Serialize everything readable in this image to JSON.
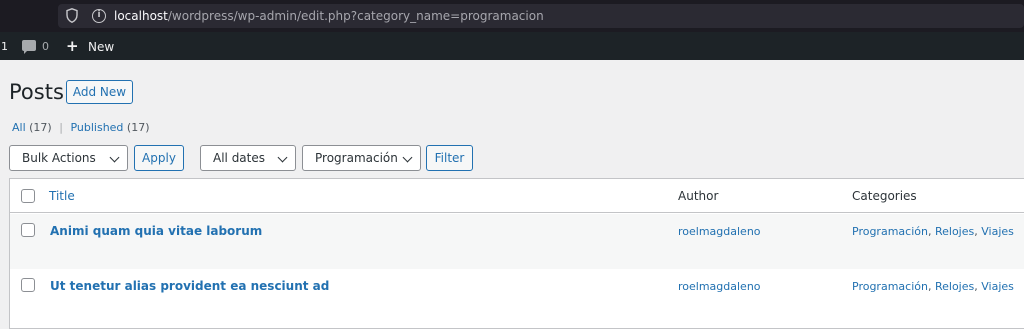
{
  "browser": {
    "url_host": "localhost",
    "url_path": "/wordpress/wp-admin/edit.php?category_name=programacion"
  },
  "adminbar": {
    "count": "1",
    "comments_count": "0",
    "new_label": "New"
  },
  "page": {
    "title": "Posts",
    "add_new_label": "Add New"
  },
  "views": {
    "all_label": "All",
    "all_count": "(17)",
    "separator": "|",
    "published_label": "Published",
    "published_count": "(17)"
  },
  "filters": {
    "bulk_actions": "Bulk Actions",
    "apply_label": "Apply",
    "dates": "All dates",
    "category": "Programación",
    "filter_label": "Filter"
  },
  "table": {
    "columns": [
      "Title",
      "Author",
      "Categories"
    ],
    "rows": [
      {
        "title": "Animi quam quia vitae laborum",
        "author": "roelmagdaleno",
        "categories": [
          "Programación",
          "Relojes",
          "Viajes"
        ]
      },
      {
        "title": "Ut tenetur alias provident ea nesciunt ad",
        "author": "roelmagdaleno",
        "categories": [
          "Programación",
          "Relojes",
          "Viajes"
        ]
      }
    ]
  },
  "colors": {
    "link": "#2271b1",
    "adminbar": "#1d2327",
    "page_bg": "#f0f0f1"
  }
}
